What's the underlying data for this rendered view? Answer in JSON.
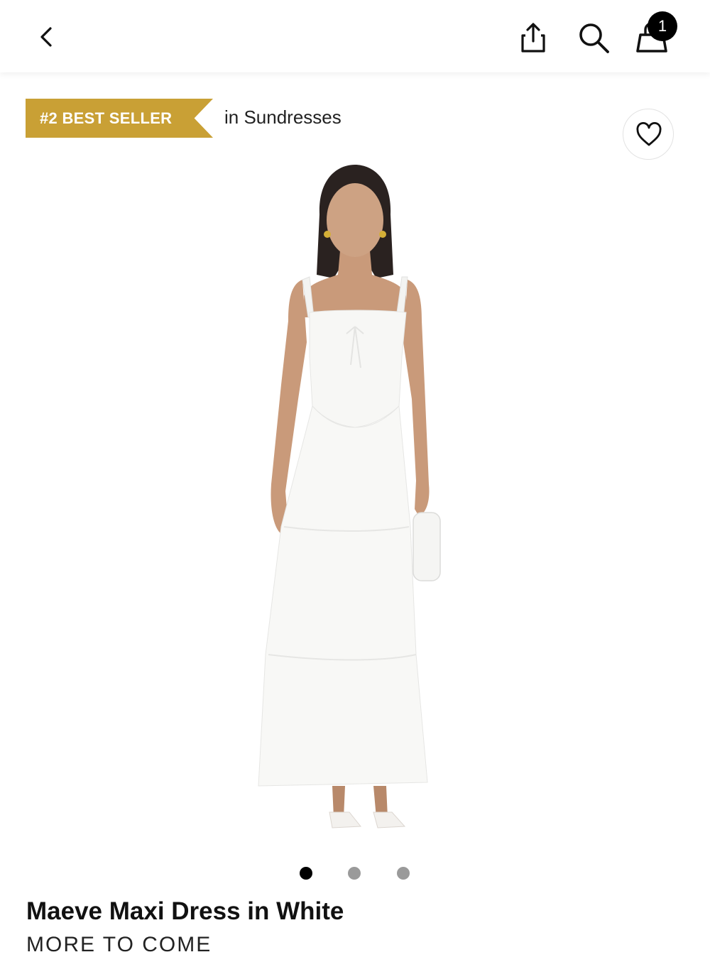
{
  "header": {
    "back_label": "Back",
    "share_label": "Share",
    "search_label": "Search",
    "cart_count": "1",
    "accent": "#000000"
  },
  "badge": {
    "rank_label": "#2 BEST SELLER",
    "category_label": "in Sundresses",
    "color": "#c9a035"
  },
  "wishlist": {
    "icon": "heart-icon"
  },
  "gallery": {
    "image_count": 3,
    "active_index": 0
  },
  "product": {
    "title": "Maeve Maxi Dress in White",
    "brand": "MORE TO COME"
  }
}
